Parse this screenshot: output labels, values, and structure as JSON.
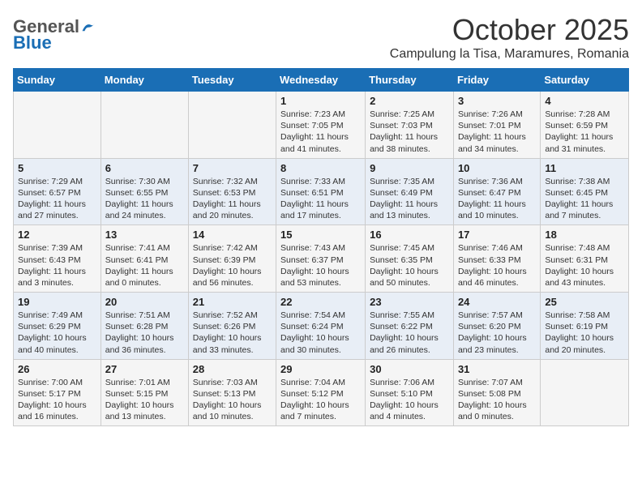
{
  "logo": {
    "general": "General",
    "blue": "Blue"
  },
  "title": "October 2025",
  "subtitle": "Campulung la Tisa, Maramures, Romania",
  "days_of_week": [
    "Sunday",
    "Monday",
    "Tuesday",
    "Wednesday",
    "Thursday",
    "Friday",
    "Saturday"
  ],
  "weeks": [
    [
      {
        "day": "",
        "info": ""
      },
      {
        "day": "",
        "info": ""
      },
      {
        "day": "",
        "info": ""
      },
      {
        "day": "1",
        "info": "Sunrise: 7:23 AM\nSunset: 7:05 PM\nDaylight: 11 hours and 41 minutes."
      },
      {
        "day": "2",
        "info": "Sunrise: 7:25 AM\nSunset: 7:03 PM\nDaylight: 11 hours and 38 minutes."
      },
      {
        "day": "3",
        "info": "Sunrise: 7:26 AM\nSunset: 7:01 PM\nDaylight: 11 hours and 34 minutes."
      },
      {
        "day": "4",
        "info": "Sunrise: 7:28 AM\nSunset: 6:59 PM\nDaylight: 11 hours and 31 minutes."
      }
    ],
    [
      {
        "day": "5",
        "info": "Sunrise: 7:29 AM\nSunset: 6:57 PM\nDaylight: 11 hours and 27 minutes."
      },
      {
        "day": "6",
        "info": "Sunrise: 7:30 AM\nSunset: 6:55 PM\nDaylight: 11 hours and 24 minutes."
      },
      {
        "day": "7",
        "info": "Sunrise: 7:32 AM\nSunset: 6:53 PM\nDaylight: 11 hours and 20 minutes."
      },
      {
        "day": "8",
        "info": "Sunrise: 7:33 AM\nSunset: 6:51 PM\nDaylight: 11 hours and 17 minutes."
      },
      {
        "day": "9",
        "info": "Sunrise: 7:35 AM\nSunset: 6:49 PM\nDaylight: 11 hours and 13 minutes."
      },
      {
        "day": "10",
        "info": "Sunrise: 7:36 AM\nSunset: 6:47 PM\nDaylight: 11 hours and 10 minutes."
      },
      {
        "day": "11",
        "info": "Sunrise: 7:38 AM\nSunset: 6:45 PM\nDaylight: 11 hours and 7 minutes."
      }
    ],
    [
      {
        "day": "12",
        "info": "Sunrise: 7:39 AM\nSunset: 6:43 PM\nDaylight: 11 hours and 3 minutes."
      },
      {
        "day": "13",
        "info": "Sunrise: 7:41 AM\nSunset: 6:41 PM\nDaylight: 11 hours and 0 minutes."
      },
      {
        "day": "14",
        "info": "Sunrise: 7:42 AM\nSunset: 6:39 PM\nDaylight: 10 hours and 56 minutes."
      },
      {
        "day": "15",
        "info": "Sunrise: 7:43 AM\nSunset: 6:37 PM\nDaylight: 10 hours and 53 minutes."
      },
      {
        "day": "16",
        "info": "Sunrise: 7:45 AM\nSunset: 6:35 PM\nDaylight: 10 hours and 50 minutes."
      },
      {
        "day": "17",
        "info": "Sunrise: 7:46 AM\nSunset: 6:33 PM\nDaylight: 10 hours and 46 minutes."
      },
      {
        "day": "18",
        "info": "Sunrise: 7:48 AM\nSunset: 6:31 PM\nDaylight: 10 hours and 43 minutes."
      }
    ],
    [
      {
        "day": "19",
        "info": "Sunrise: 7:49 AM\nSunset: 6:29 PM\nDaylight: 10 hours and 40 minutes."
      },
      {
        "day": "20",
        "info": "Sunrise: 7:51 AM\nSunset: 6:28 PM\nDaylight: 10 hours and 36 minutes."
      },
      {
        "day": "21",
        "info": "Sunrise: 7:52 AM\nSunset: 6:26 PM\nDaylight: 10 hours and 33 minutes."
      },
      {
        "day": "22",
        "info": "Sunrise: 7:54 AM\nSunset: 6:24 PM\nDaylight: 10 hours and 30 minutes."
      },
      {
        "day": "23",
        "info": "Sunrise: 7:55 AM\nSunset: 6:22 PM\nDaylight: 10 hours and 26 minutes."
      },
      {
        "day": "24",
        "info": "Sunrise: 7:57 AM\nSunset: 6:20 PM\nDaylight: 10 hours and 23 minutes."
      },
      {
        "day": "25",
        "info": "Sunrise: 7:58 AM\nSunset: 6:19 PM\nDaylight: 10 hours and 20 minutes."
      }
    ],
    [
      {
        "day": "26",
        "info": "Sunrise: 7:00 AM\nSunset: 5:17 PM\nDaylight: 10 hours and 16 minutes."
      },
      {
        "day": "27",
        "info": "Sunrise: 7:01 AM\nSunset: 5:15 PM\nDaylight: 10 hours and 13 minutes."
      },
      {
        "day": "28",
        "info": "Sunrise: 7:03 AM\nSunset: 5:13 PM\nDaylight: 10 hours and 10 minutes."
      },
      {
        "day": "29",
        "info": "Sunrise: 7:04 AM\nSunset: 5:12 PM\nDaylight: 10 hours and 7 minutes."
      },
      {
        "day": "30",
        "info": "Sunrise: 7:06 AM\nSunset: 5:10 PM\nDaylight: 10 hours and 4 minutes."
      },
      {
        "day": "31",
        "info": "Sunrise: 7:07 AM\nSunset: 5:08 PM\nDaylight: 10 hours and 0 minutes."
      },
      {
        "day": "",
        "info": ""
      }
    ]
  ]
}
